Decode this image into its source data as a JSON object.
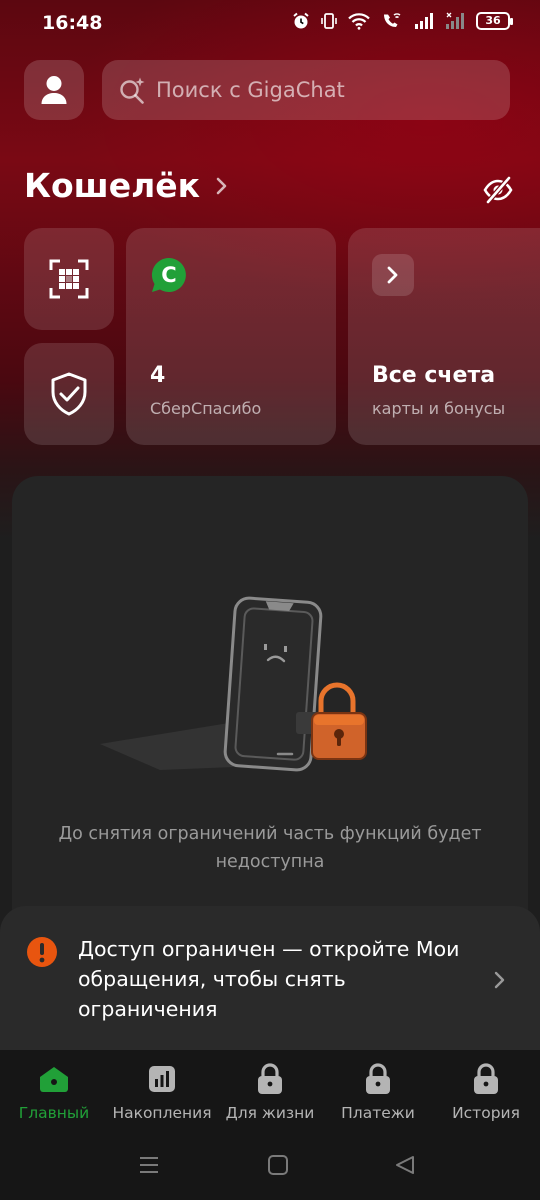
{
  "status_bar": {
    "time": "16:48",
    "battery": "36",
    "icons": [
      "alarm-icon",
      "vibrate-icon",
      "wifi-icon",
      "wifi-call-icon",
      "signal-icon",
      "signal-icon"
    ]
  },
  "header": {
    "avatar_icon": "user-icon",
    "search_placeholder": "Поиск с GigaChat"
  },
  "wallet": {
    "title": "Кошелёк",
    "hide_balance_icon": "eye-off-icon"
  },
  "tiles": {
    "qr_icon": "qr-scan-icon",
    "shield_icon": "shield-check-icon",
    "spasibo": {
      "value": "4",
      "label": "СберСпасибо",
      "logo": "С",
      "color": "#21a038"
    },
    "accounts": {
      "title": "Все счета",
      "subtitle": "карты и бонусы"
    }
  },
  "restricted": {
    "message": "До снятия ограничений часть функций будет недоступна",
    "accent": "#e8742c"
  },
  "alert": {
    "text": "Доступ ограничен — откройте Мои обращения, чтобы снять ограничения",
    "color": "#e8550f"
  },
  "bottom_nav": [
    {
      "label": "Главный",
      "icon": "home-icon",
      "active": true
    },
    {
      "label": "Накопления",
      "icon": "chart-icon",
      "active": false
    },
    {
      "label": "Для жизни",
      "icon": "lock-icon",
      "active": false
    },
    {
      "label": "Платежи",
      "icon": "lock-icon",
      "active": false
    },
    {
      "label": "История",
      "icon": "lock-icon",
      "active": false
    }
  ],
  "colors": {
    "accent_green": "#21a038",
    "background": "#1e1e1e",
    "header_red": "#7a0914"
  }
}
